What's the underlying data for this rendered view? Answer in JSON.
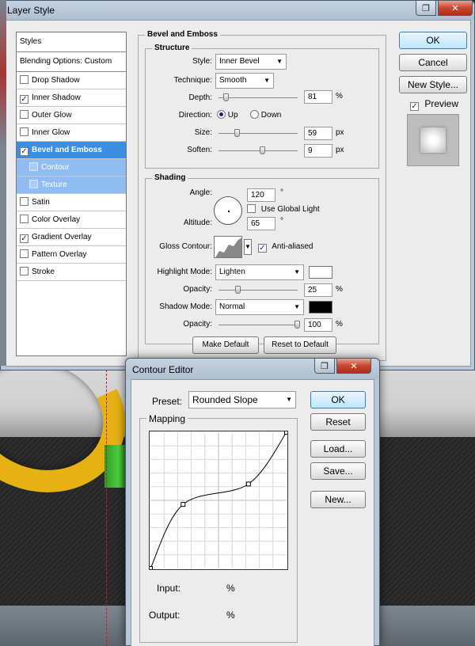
{
  "layer_style": {
    "title": "Layer Style",
    "styles_header": "Styles",
    "blending_options": "Blending Options: Custom",
    "styles": [
      {
        "label": "Drop Shadow",
        "checked": false
      },
      {
        "label": "Inner Shadow",
        "checked": true
      },
      {
        "label": "Outer Glow",
        "checked": false
      },
      {
        "label": "Inner Glow",
        "checked": false
      },
      {
        "label": "Bevel and Emboss",
        "checked": true,
        "selected": true
      },
      {
        "label": "Contour",
        "checked": false,
        "sub": true
      },
      {
        "label": "Texture",
        "checked": false,
        "sub": true
      },
      {
        "label": "Satin",
        "checked": false
      },
      {
        "label": "Color Overlay",
        "checked": false
      },
      {
        "label": "Gradient Overlay",
        "checked": true
      },
      {
        "label": "Pattern Overlay",
        "checked": false
      },
      {
        "label": "Stroke",
        "checked": false
      }
    ],
    "section_title": "Bevel and Emboss",
    "structure": {
      "legend": "Structure",
      "style_label": "Style:",
      "style_value": "Inner Bevel",
      "technique_label": "Technique:",
      "technique_value": "Smooth",
      "depth_label": "Depth:",
      "depth_value": "81",
      "depth_unit": "%",
      "depth_fraction": 0.081,
      "direction_label": "Direction:",
      "direction_up": "Up",
      "direction_down": "Down",
      "size_label": "Size:",
      "size_value": "59",
      "size_unit": "px",
      "soften_label": "Soften:",
      "soften_value": "9",
      "soften_unit": "px"
    },
    "shading": {
      "legend": "Shading",
      "angle_label": "Angle:",
      "angle_value": "120",
      "angle_unit": "°",
      "global_light_label": "Use Global Light",
      "global_light_checked": false,
      "altitude_label": "Altitude:",
      "altitude_value": "65",
      "altitude_unit": "°",
      "gloss_label": "Gloss Contour:",
      "anti_aliased_label": "Anti-aliased",
      "anti_aliased_checked": true,
      "highlight_mode_label": "Highlight Mode:",
      "highlight_mode_value": "Lighten",
      "highlight_color": "#ffffff",
      "highlight_opacity_label": "Opacity:",
      "highlight_opacity_value": "25",
      "highlight_opacity_unit": "%",
      "shadow_mode_label": "Shadow Mode:",
      "shadow_mode_value": "Normal",
      "shadow_color": "#000000",
      "shadow_opacity_label": "Opacity:",
      "shadow_opacity_value": "100",
      "shadow_opacity_unit": "%"
    },
    "make_default": "Make Default",
    "reset_to_default": "Reset to Default",
    "ok": "OK",
    "cancel": "Cancel",
    "new_style": "New Style...",
    "preview_label": "Preview",
    "preview_checked": true
  },
  "contour_editor": {
    "title": "Contour Editor",
    "preset_label": "Preset:",
    "preset_value": "Rounded Slope",
    "mapping_legend": "Mapping",
    "input_label": "Input:",
    "input_unit": "%",
    "output_label": "Output:",
    "output_unit": "%",
    "ok": "OK",
    "reset": "Reset",
    "load": "Load...",
    "save": "Save...",
    "new": "New...",
    "curve_points": [
      [
        0,
        0
      ],
      [
        24,
        47
      ],
      [
        72,
        62
      ],
      [
        100,
        100
      ]
    ]
  },
  "title_buttons": {
    "restore_glyph": "❐",
    "close_glyph": "✕"
  }
}
